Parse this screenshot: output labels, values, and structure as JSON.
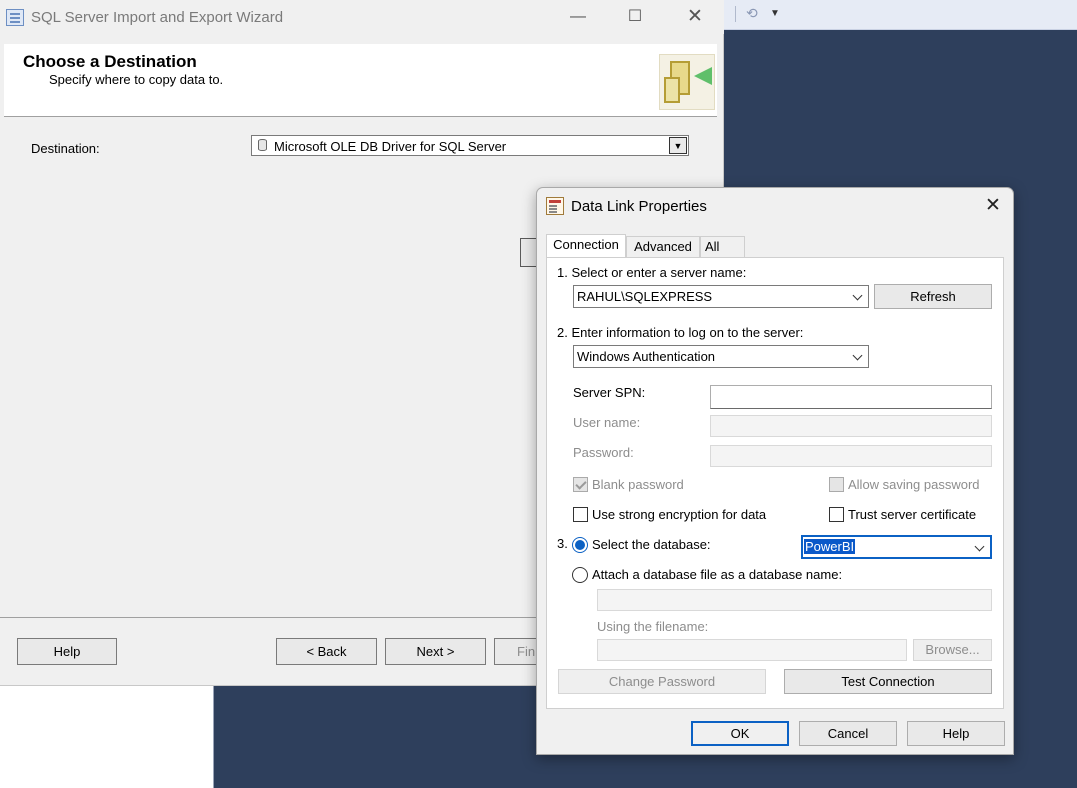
{
  "wizard": {
    "title": "SQL Server Import and Export Wizard",
    "heading": "Choose a Destination",
    "subheading": "Specify where to copy data to.",
    "destination_label": "Destination:",
    "destination_value": "Microsoft OLE DB Driver for SQL Server",
    "buttons": {
      "help": "Help",
      "back": "< Back",
      "next": "Next >",
      "finish": "Fin"
    }
  },
  "dialog": {
    "title": "Data Link Properties",
    "tabs": [
      "Connection",
      "Advanced",
      "All"
    ],
    "step1_label": "1. Select or enter a server name:",
    "server_name": "RAHUL\\SQLEXPRESS",
    "refresh_label": "Refresh",
    "step2_label": "2. Enter information to log on to the server:",
    "auth_mode": "Windows Authentication",
    "server_spn_label": "Server SPN:",
    "user_name_label": "User name:",
    "password_label": "Password:",
    "blank_password_label": "Blank password",
    "allow_saving_label": "Allow saving password",
    "strong_encryption_label": "Use strong encryption for data",
    "trust_cert_label": "Trust server certificate",
    "step3_number": "3.",
    "select_db_label": "Select the database:",
    "database_value": "PowerBI",
    "attach_label": "Attach a database file as a database name:",
    "using_filename_label": "Using the filename:",
    "browse_label": "Browse...",
    "change_password_label": "Change Password",
    "test_connection_label": "Test Connection",
    "ok_label": "OK",
    "cancel_label": "Cancel",
    "help_label": "Help"
  },
  "colors": {
    "accent": "#0b61c4",
    "desktop": "#2e3f5c"
  }
}
